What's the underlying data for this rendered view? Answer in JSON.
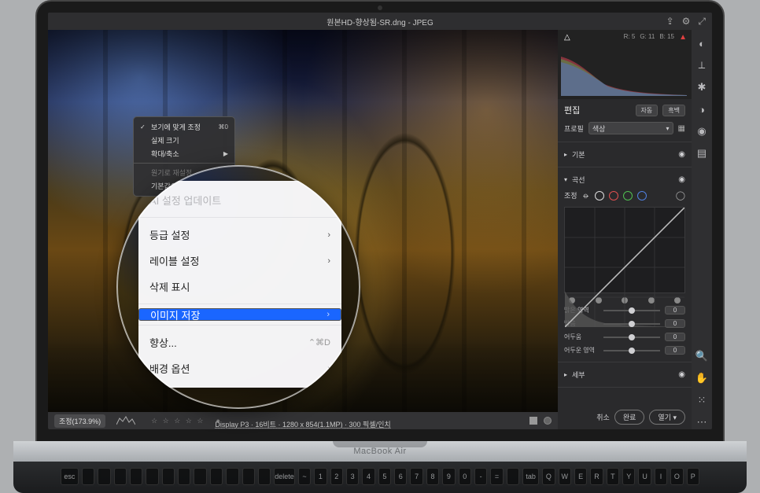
{
  "title": "원본HD-향상됨-SR.dng  -  JPEG",
  "toolbar_icons": {
    "share": "share-icon",
    "gear": "gear-icon",
    "expand": "expand-icon"
  },
  "histogram_meta": {
    "r": "R: 5",
    "g": "G: 11",
    "b": "B: 15"
  },
  "edit_panel": {
    "title": "편집",
    "btn_auto": "자동",
    "btn_bw": "흑백",
    "profile_label": "프로필",
    "profile_value": "색상",
    "group_basic": "기본",
    "group_curve": "곡선",
    "adj_label": "조정",
    "sliders": [
      {
        "label": "밝은 영역",
        "value": "0",
        "pos": 50
      },
      {
        "label": "밝음",
        "value": "0",
        "pos": 50
      },
      {
        "label": "어두움",
        "value": "0",
        "pos": 50
      },
      {
        "label": "어두운 영역",
        "value": "0",
        "pos": 50
      }
    ],
    "detail": "세부"
  },
  "footer": {
    "cancel": "취소",
    "done": "완료",
    "open": "열기"
  },
  "statusbar": {
    "zoom": "조정(173.9%)",
    "info": "Display P3 · 16비트 · 1280 x 854(1.1MP) · 300 픽셀/인치"
  },
  "small_menu": {
    "items": [
      {
        "label": "보기에 맞게 조정",
        "checked": true,
        "kb": "⌘0"
      },
      {
        "label": "실제 크기"
      },
      {
        "label": "확대/축소",
        "submenu": true
      }
    ],
    "sep1": true,
    "items2": [
      {
        "label": "원기로 재설정",
        "dim": true
      },
      {
        "label": "기본값으로 재설정"
      }
    ]
  },
  "mag_menu": {
    "items": [
      {
        "label": "AI 설정 업데이트",
        "dim": true,
        "submenu": true
      },
      {
        "sep": true
      },
      {
        "label": "등급 설정",
        "submenu": true
      },
      {
        "label": "레이블 설정",
        "submenu": true
      },
      {
        "label": "삭제 표시"
      },
      {
        "sep": true
      },
      {
        "label": "이미지 저장",
        "submenu": true,
        "selected": true
      },
      {
        "sep": true
      },
      {
        "label": "향상...",
        "kb": "⌃⌘D"
      },
      {
        "label": "배경 옵션",
        "submenu": true
      }
    ]
  },
  "laptop": {
    "brand": "MacBook Air"
  },
  "keys": [
    "esc",
    "",
    "",
    "",
    "",
    "",
    "",
    "",
    "",
    "",
    "",
    "",
    "",
    "delete",
    "~",
    "1",
    "2",
    "3",
    "4",
    "5",
    "6",
    "7",
    "8",
    "9",
    "0",
    "-",
    "=",
    "",
    "tab",
    "Q",
    "W",
    "E",
    "R",
    "T",
    "Y",
    "U",
    "I",
    "O",
    "P"
  ]
}
